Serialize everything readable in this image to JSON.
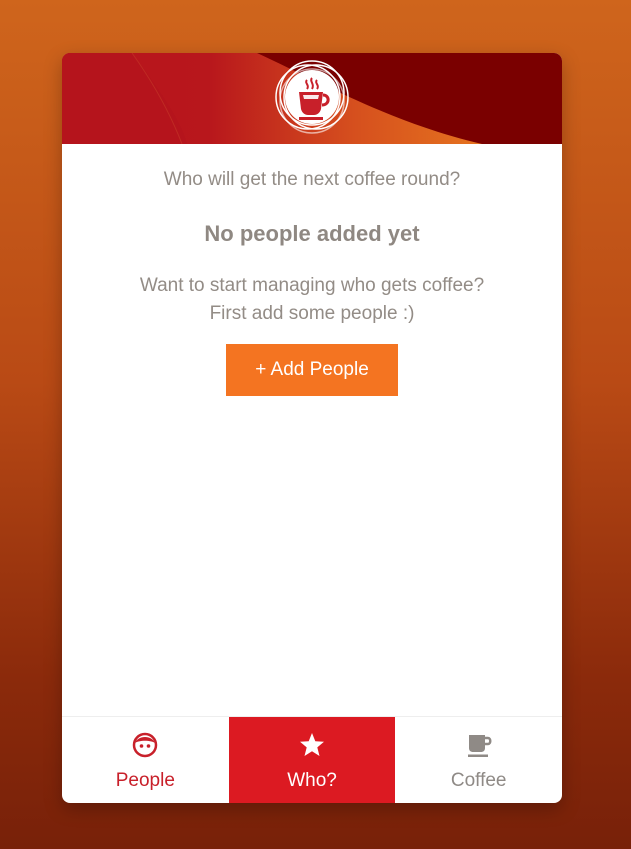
{
  "header": {
    "logo_icon": "coffee-cup-icon",
    "colors": {
      "red": "#b8141c",
      "dark_red": "#7a0000",
      "orange": "#e06a1e"
    }
  },
  "main": {
    "question": "Who will get the next coffee round?",
    "empty_title": "No people added yet",
    "hint_line1": "Want to start managing who gets coffee?",
    "hint_line2": "First add some people :)",
    "add_button_label": "+ Add People",
    "accent_color": "#f47421"
  },
  "tabs": [
    {
      "label": "People",
      "icon": "face-icon",
      "active": false
    },
    {
      "label": "Who?",
      "icon": "star-icon",
      "active": true
    },
    {
      "label": "Coffee",
      "icon": "coffee-cup-icon",
      "active": false
    }
  ]
}
